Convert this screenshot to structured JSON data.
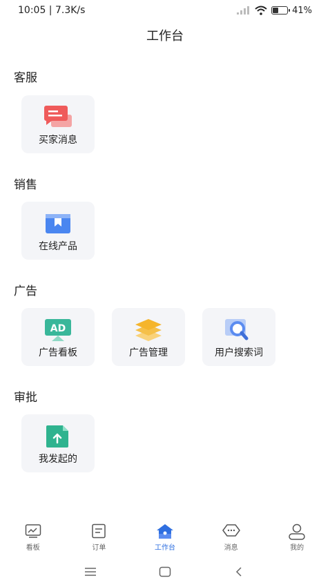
{
  "status_bar": {
    "time": "10:05 | 7.3K/s",
    "battery": "41%",
    "battery_level": 0.41
  },
  "page_title": "工作台",
  "sections": [
    {
      "title": "客服",
      "items": [
        {
          "label": "买家消息",
          "icon": "chat-bubble-icon"
        }
      ]
    },
    {
      "title": "销售",
      "items": [
        {
          "label": "在线产品",
          "icon": "product-box-icon"
        }
      ]
    },
    {
      "title": "广告",
      "items": [
        {
          "label": "广告看板",
          "icon": "ad-board-icon"
        },
        {
          "label": "广告管理",
          "icon": "layers-icon"
        },
        {
          "label": "用户搜索词",
          "icon": "search-icon"
        }
      ]
    },
    {
      "title": "审批",
      "items": [
        {
          "label": "我发起的",
          "icon": "upload-file-icon"
        }
      ]
    }
  ],
  "ad_icon_text": "AD",
  "tabs": [
    {
      "label": "看板",
      "icon": "dashboard-icon"
    },
    {
      "label": "订单",
      "icon": "order-icon"
    },
    {
      "label": "工作台",
      "icon": "workbench-icon",
      "active": true
    },
    {
      "label": "消息",
      "icon": "message-icon"
    },
    {
      "label": "我的",
      "icon": "profile-icon"
    }
  ],
  "colors": {
    "accent": "#2f6fe0",
    "card_bg": "#f4f5f8",
    "chat": "#ef5b5b",
    "product": "#4a86f0",
    "ad": "#39b79a",
    "layers": "#f5b52c",
    "search": "#5b8cf0",
    "approval": "#2fb38f"
  }
}
